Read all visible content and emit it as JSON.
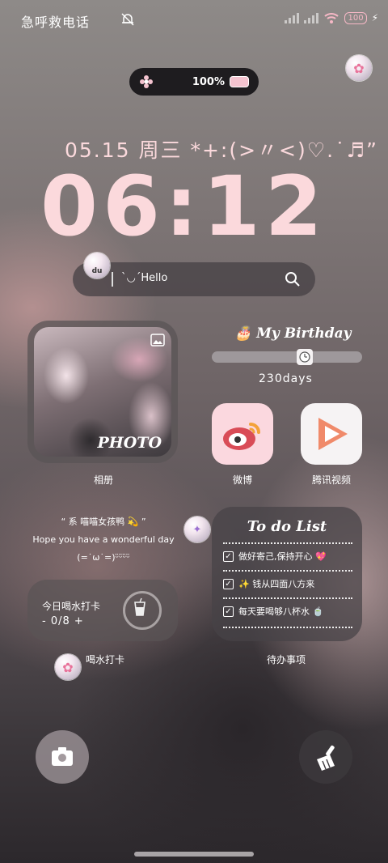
{
  "status_bar": {
    "carrier": "急呼救电话",
    "battery": "100"
  },
  "battery_widget": {
    "percent": "100%"
  },
  "clock": {
    "date": "05.15 周三 *+:(>〃<)♡.˙♬”",
    "time": "06:12"
  },
  "search": {
    "text": "ˋ◡ˊHello",
    "badge": "du"
  },
  "photo_widget": {
    "overlay": "PHOTO",
    "label": "相册"
  },
  "birthday": {
    "title": "My Birthday",
    "days": "230days",
    "progress": 0.63
  },
  "apps": [
    {
      "label": "微博"
    },
    {
      "label": "腾讯视频"
    }
  ],
  "quote": {
    "line1": "“ 系 喵喵女孩鸭 💫 ”",
    "line2": "Hope you have a wonderful day",
    "line3": "(=˙ω˙=)ᵕ̈ᵕ̈ᵕ̈ᵕ̈"
  },
  "water": {
    "title": "今日喝水打卡",
    "count": "- 0/8 +",
    "label": "喝水打卡"
  },
  "todo": {
    "title": "To do List",
    "items": [
      "做好寄己,保持开心 💖",
      "✨ 钱从四面八方来",
      "每天要喝够八杯水 🍵"
    ],
    "label": "待办事项"
  },
  "colors": {
    "pink": "#fbd9dc",
    "accent": "#f6b8c6"
  }
}
